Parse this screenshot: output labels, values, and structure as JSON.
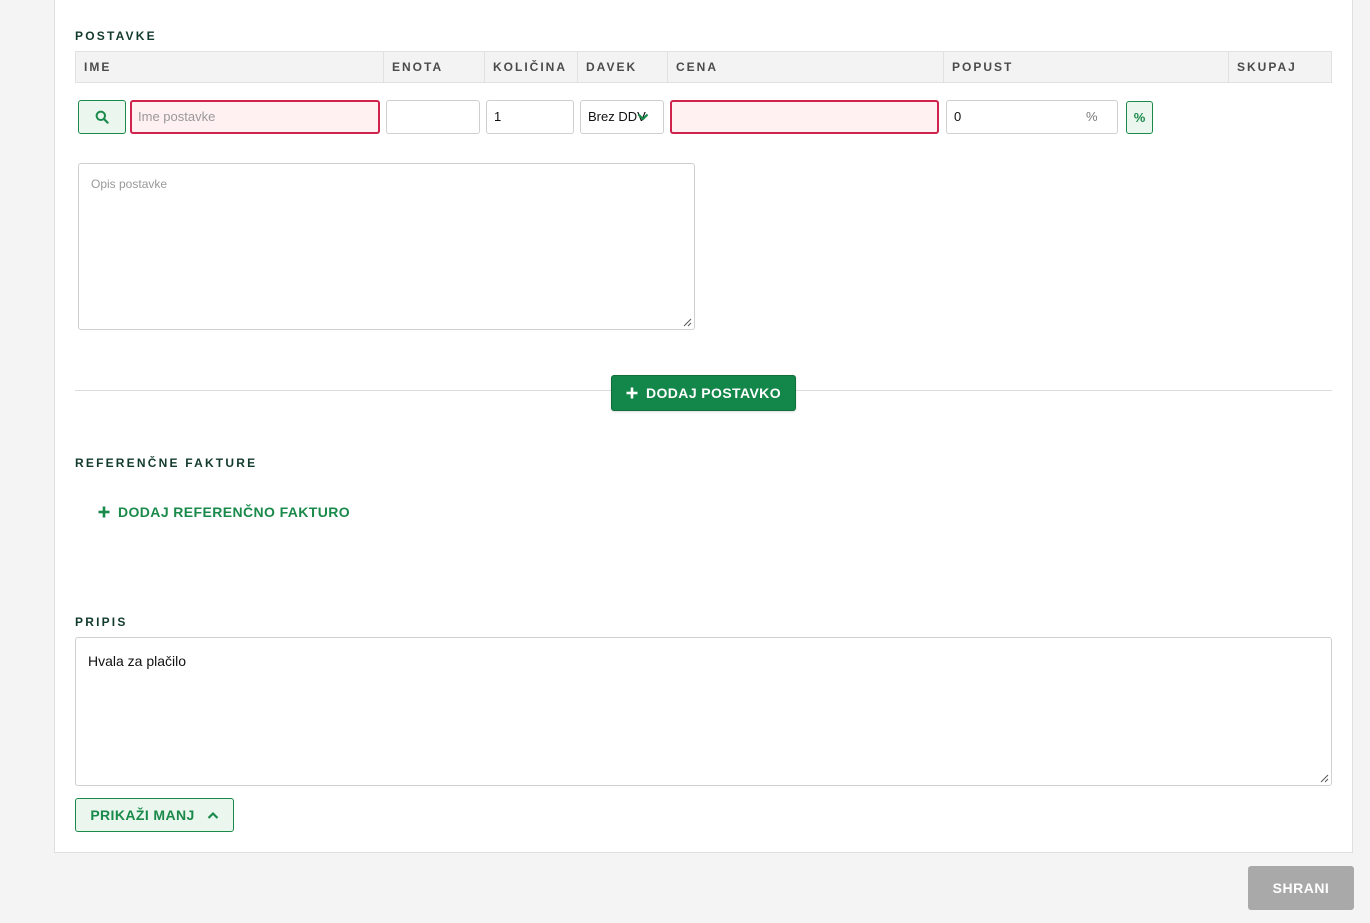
{
  "items_section": {
    "title": "POSTAVKE",
    "columns": [
      "IME",
      "ENOTA",
      "KOLIČINA",
      "DAVEK",
      "CENA",
      "POPUST",
      "SKUPAJ"
    ],
    "row": {
      "name_placeholder": "Ime postavke",
      "unit_value": "",
      "quantity_value": "1",
      "tax_value": "Brez DDV",
      "price_value": "",
      "discount_value": "0",
      "discount_unit": "%",
      "discount_toggle_label": "%",
      "description_placeholder": "Opis postavke"
    },
    "add_item_label": "DODAJ POSTAVKO"
  },
  "reference_section": {
    "title": "REFERENČNE FAKTURE",
    "add_reference_label": "DODAJ REFERENČNO FAKTURO"
  },
  "note_section": {
    "title": "PRIPIS",
    "note_value": "Hvala za plačilo"
  },
  "show_less_label": "PRIKAŽI MANJ",
  "save_label": "SHRANI",
  "icons": {
    "search": "search-icon",
    "tax_dropdown": "chevron-down-icon",
    "plus": "plus-icon",
    "chevron_up": "chevron-up-icon"
  },
  "colors": {
    "accent_green": "#13864a",
    "error_red": "#d0234b",
    "save_disabled": "#a9a9a9"
  }
}
